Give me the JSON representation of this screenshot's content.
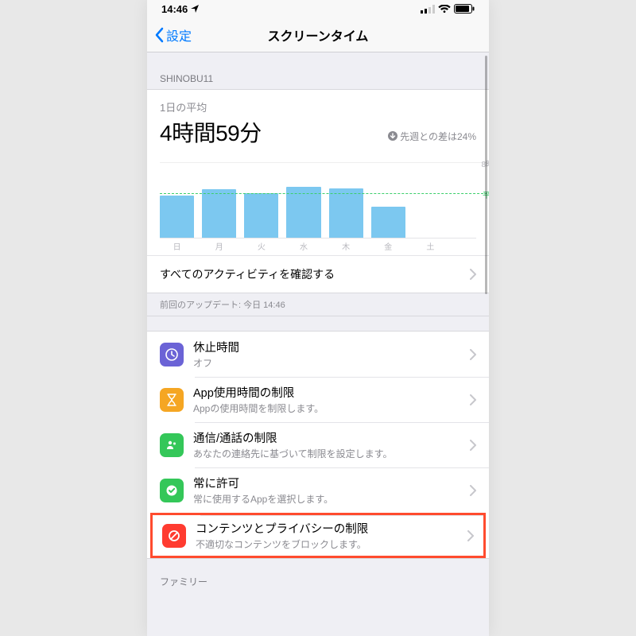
{
  "statusbar": {
    "time": "14:46"
  },
  "navbar": {
    "back": "設定",
    "title": "スクリーンタイム"
  },
  "section_header": "SHINOBU11",
  "summary": {
    "avg_label": "1日の平均",
    "avg_value": "4時間59分",
    "diff_text": "先週との差は24%"
  },
  "chart_data": {
    "type": "bar",
    "categories": [
      "日",
      "月",
      "火",
      "水",
      "木",
      "金",
      "土"
    ],
    "values": [
      4.7,
      5.3,
      4.9,
      5.5,
      5.4,
      3.4,
      0
    ],
    "avg_line": 4.98,
    "ylim": [
      0,
      8
    ],
    "max_label": "8時間",
    "avg_label": "平均"
  },
  "activity_link": "すべてのアクティビティを確認する",
  "update_note": "前回のアップデート: 今日 14:46",
  "rows": {
    "downtime": {
      "title": "休止時間",
      "sub": "オフ"
    },
    "applimits": {
      "title": "App使用時間の制限",
      "sub": "Appの使用時間を制限します。"
    },
    "comm": {
      "title": "通信/通話の制限",
      "sub": "あなたの連絡先に基づいて制限を設定します。"
    },
    "always": {
      "title": "常に許可",
      "sub": "常に使用するAppを選択します。"
    },
    "content": {
      "title": "コンテンツとプライバシーの制限",
      "sub": "不適切なコンテンツをブロックします。"
    }
  },
  "family_header": "ファミリー",
  "icon_colors": {
    "downtime": "#6b63d6",
    "applimits": "#f5a623",
    "comm": "#34c759",
    "always": "#34c759",
    "content": "#ff3b30"
  }
}
